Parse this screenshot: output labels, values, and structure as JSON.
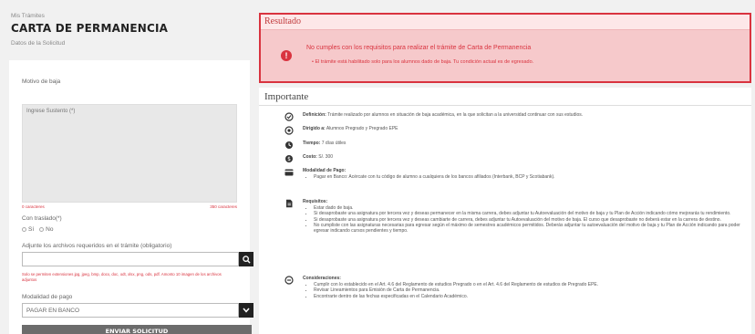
{
  "header": {
    "breadcrumb": "Mis Trámites",
    "title": "CARTA DE PERMANENCIA",
    "subtitle": "Datos de la Solicitud"
  },
  "form": {
    "reason_label": "Motivo de baja",
    "reason_placeholder": "Ingrese Sustento (*)",
    "counter_left": "0 caracteres",
    "counter_right": "350 caracteres",
    "transfer_label": "Con traslado(*)",
    "option_yes": "Sí",
    "option_no": "No",
    "files_label": "Adjunte los archivos requeridos en el trámite (obligatorio)",
    "files_note": "Solo se permiten extensiones jpg, jpeg, bmp, docx, doc, odt, xlsx, png, ods, pdf. Amonto 10 imagen de los archivos adjuntos",
    "payment_label": "Modalidad de pago",
    "payment_value": "PAGAR EN BANCO",
    "submit_label": "ENVIAR SOLICITUD"
  },
  "result": {
    "heading": "Resultado",
    "message": "No cumples con los requisitos para realizar el trámite de Carta de Permanencia",
    "detail": "El trámite está habilitado solo para los alumnos dado de baja. Tu condición actual es de egresado."
  },
  "important": {
    "heading": "Importante",
    "definition_label": "Definición:",
    "definition_text": "Trámite realizado por alumnos en situación de baja académica, en la que solicitan a la universidad continuar con sus estudios.",
    "directed_label": "Dirigido a:",
    "directed_text": "Alumnos Pregrado y Pregrado EPE",
    "time_label": "Tiempo:",
    "time_text": "7 días útiles",
    "cost_label": "Costo:",
    "cost_text": "S/. 300",
    "payment_label": "Modalidad de Pago:",
    "payment_items": [
      "Pagar en Banco: Acércate con tu código de alumno a cualquiera de los bancos afiliados (Interbank, BCP y Scotiabank)."
    ],
    "requirements_label": "Requisitos:",
    "requirements_items": [
      "Estar dado de baja.",
      "Si desaprobaste una asignatura por tercera vez y deseas permanecer en la misma carrera, debes adjuntar tu Autoevaluación del motivo de baja y tu Plan de Acción indicando cómo mejorarás tu rendimiento.",
      "Si desaprobaste una asignatura por tercera vez y deseas cambiarte de carrera, debes adjuntar tu Autoevaluación del motivo de baja. El curso que desaprobaste no deberá estar en la carrera de destino.",
      "No cumpliste con las asignaturas necesarias para egresar según el máximo de semestres académicos permitidos. Deberás adjuntar tu autoevaluación del motivo de baja y tu Plan de Acción indicando para poder egresar indicando cursos pendientes y tiempo."
    ],
    "considerations_label": "Consideraciones:",
    "considerations_items": [
      "Cumplir con lo establecido en el Art. 4.6 del Reglamento de estudios Pregrado o en el Art. 4.6 del Reglamento de estudios de Pregrado EPE.",
      "Revisar Lineamientos para Emisión de Carta de Permanencia.",
      "Encontrarte dentro de las fechas especificadas en el Calendario Académico."
    ]
  },
  "colors": {
    "accent": "#d9333f",
    "alert_bg": "#f6c9cb",
    "button": "#6c6c6c"
  },
  "icons": [
    "clock-check-icon",
    "target-icon",
    "clock-icon",
    "dollar-icon",
    "card-icon",
    "document-icon",
    "minus-circle-icon",
    "search-icon",
    "chevron-down-icon",
    "error-icon"
  ]
}
